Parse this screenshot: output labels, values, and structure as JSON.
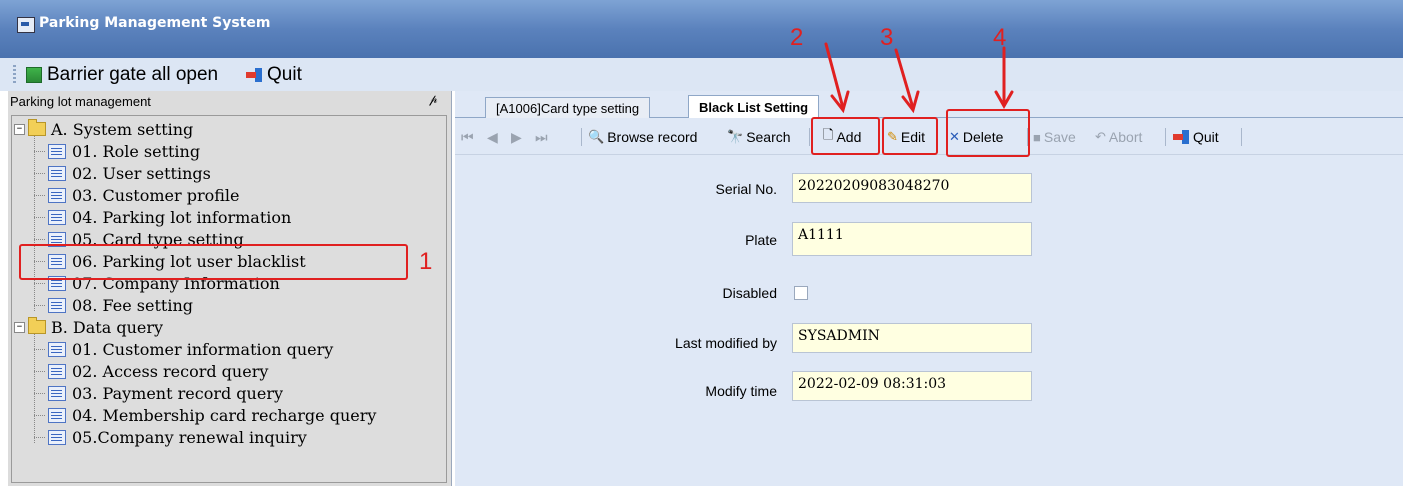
{
  "window": {
    "title": "Parking Management System"
  },
  "menu": {
    "gate_open": "Barrier gate all open",
    "quit": "Quit"
  },
  "left_panel": {
    "title": "Parking lot management",
    "pin": "ᵖ",
    "groups": [
      {
        "label": "A. System setting",
        "expander": "−",
        "items": [
          "01. Role setting",
          "02. User settings",
          "03. Customer profile",
          "04. Parking lot information",
          "05. Card type setting",
          "06. Parking lot user blacklist",
          "07. Company Information",
          "08. Fee setting"
        ]
      },
      {
        "label": "B. Data query",
        "expander": "−",
        "items": [
          "01. Customer information query",
          "02. Access record query",
          "03. Payment record query",
          "04. Membership card recharge query",
          "05.Company renewal inquiry"
        ]
      }
    ]
  },
  "tabs": [
    {
      "label": "[A1006]Card type setting",
      "active": false
    },
    {
      "label": "Black List Setting",
      "active": true
    }
  ],
  "toolbar": {
    "first": "⏮",
    "prev": "◀",
    "next": "▶",
    "last": "⏭",
    "browse": "Browse record",
    "search": "Search",
    "add": "Add",
    "edit": "Edit",
    "delete": "Delete",
    "save": "Save",
    "abort": "Abort",
    "quit": "Quit"
  },
  "form": {
    "serial_label": "Serial No.",
    "serial_value": "20220209083048270",
    "plate_label": "Plate",
    "plate_value": "A1111",
    "disabled_label": "Disabled",
    "disabled_checked": false,
    "modified_by_label": "Last modified by",
    "modified_by_value": "SYSADMIN",
    "modify_time_label": "Modify time",
    "modify_time_value": "2022-02-09 08:31:03"
  },
  "annotations": {
    "n1": "1",
    "n2": "2",
    "n3": "3",
    "n4": "4",
    "color": "#e02020"
  }
}
